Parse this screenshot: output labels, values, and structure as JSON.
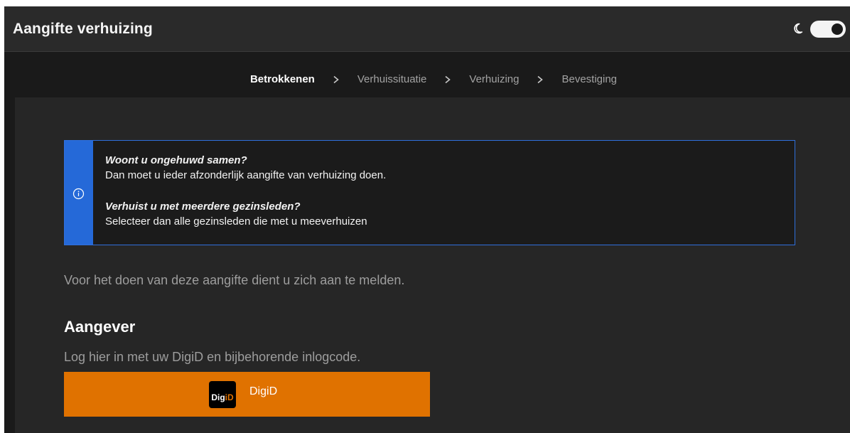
{
  "header": {
    "title": "Aangifte verhuizing",
    "theme_icon": "moon-icon",
    "theme_toggle_state": "on"
  },
  "steps": [
    {
      "label": "Betrokkenen",
      "active": true
    },
    {
      "label": "Verhuissituatie",
      "active": false
    },
    {
      "label": "Verhuizing",
      "active": false
    },
    {
      "label": "Bevestiging",
      "active": false
    }
  ],
  "notice": {
    "icon": "info-icon",
    "heading1": "Woont u ongehuwd samen?",
    "text1": "Dan moet u ieder afzonderlijk aangifte van verhuizing doen.",
    "heading2": "Verhuist u met meerdere gezinsleden?",
    "text2": "Selecteer dan alle gezinsleden die met u meeverhuizen",
    "accent_color": "#2569d8"
  },
  "main": {
    "intro": "Voor het doen van deze aangifte dient u zich aan te melden.",
    "section_title": "Aangever",
    "section_subtitle": "Log hier in met uw DigiD en bijbehorende inlogcode."
  },
  "digid_button": {
    "label": "DigiD",
    "logo_text_main": "Dig",
    "logo_text_accent": "iD",
    "color": "#e07200"
  }
}
